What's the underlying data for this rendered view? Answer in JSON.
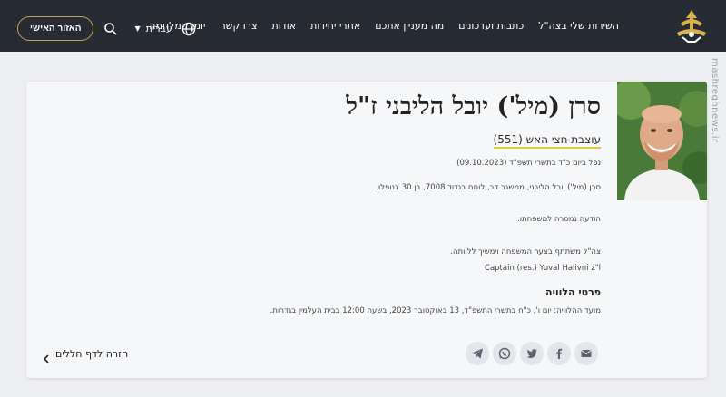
{
  "header": {
    "nav": [
      "השירות שלי בצה\"ל",
      "כתבות ועדכונים",
      "מה מעניין אתכם",
      "אתרי יחידות",
      "אודות",
      "צרו קשר",
      "יומן המלחמה"
    ],
    "language": "עברית",
    "personal_area": "האזור האישי",
    "icons": [
      "idf-logo-icon",
      "globe-icon",
      "chevron-down-icon",
      "search-icon"
    ]
  },
  "watermark": "mashreghnews.ir",
  "profile": {
    "name": "סרן (מיל') יובל הליבני ז\"ל",
    "unit": "עוצבת חצי האש (551)",
    "fell": "נפל ביום כ\"ד בתשרי תשפ\"ד (09.10.2023)",
    "description": "סרן (מיל') יובל הליבני, ממשגב דב, לוחם בגדוד 7008, בן 30 בנופלו.",
    "notified": "הודעה נמסרה למשפחתו.",
    "condolence": "צה\"ל משתתף בצער המשפחה וימשיך ללוותה.",
    "english_name": "Captain (res.) Yuval Halivni z\"l",
    "funeral_title": "פרטי הלוויה",
    "funeral_details": "מועד ההלוויה: יום ו', כ\"ח בתשרי התשפ\"ד, 13 באוקטובר 2023, בשעה 12:00 בבית העלמין בגדרות."
  },
  "share": {
    "buttons": [
      "telegram-icon",
      "whatsapp-icon",
      "twitter-icon",
      "facebook-icon",
      "email-icon"
    ]
  },
  "back_link": "חזרה לדף חללים",
  "colors": {
    "header_bg": "#262b34",
    "accent_gold": "#c7a24a",
    "underline_yellow": "#e9c83a",
    "page_bg": "#edeef2",
    "card_bg": "#f6f7f9"
  }
}
